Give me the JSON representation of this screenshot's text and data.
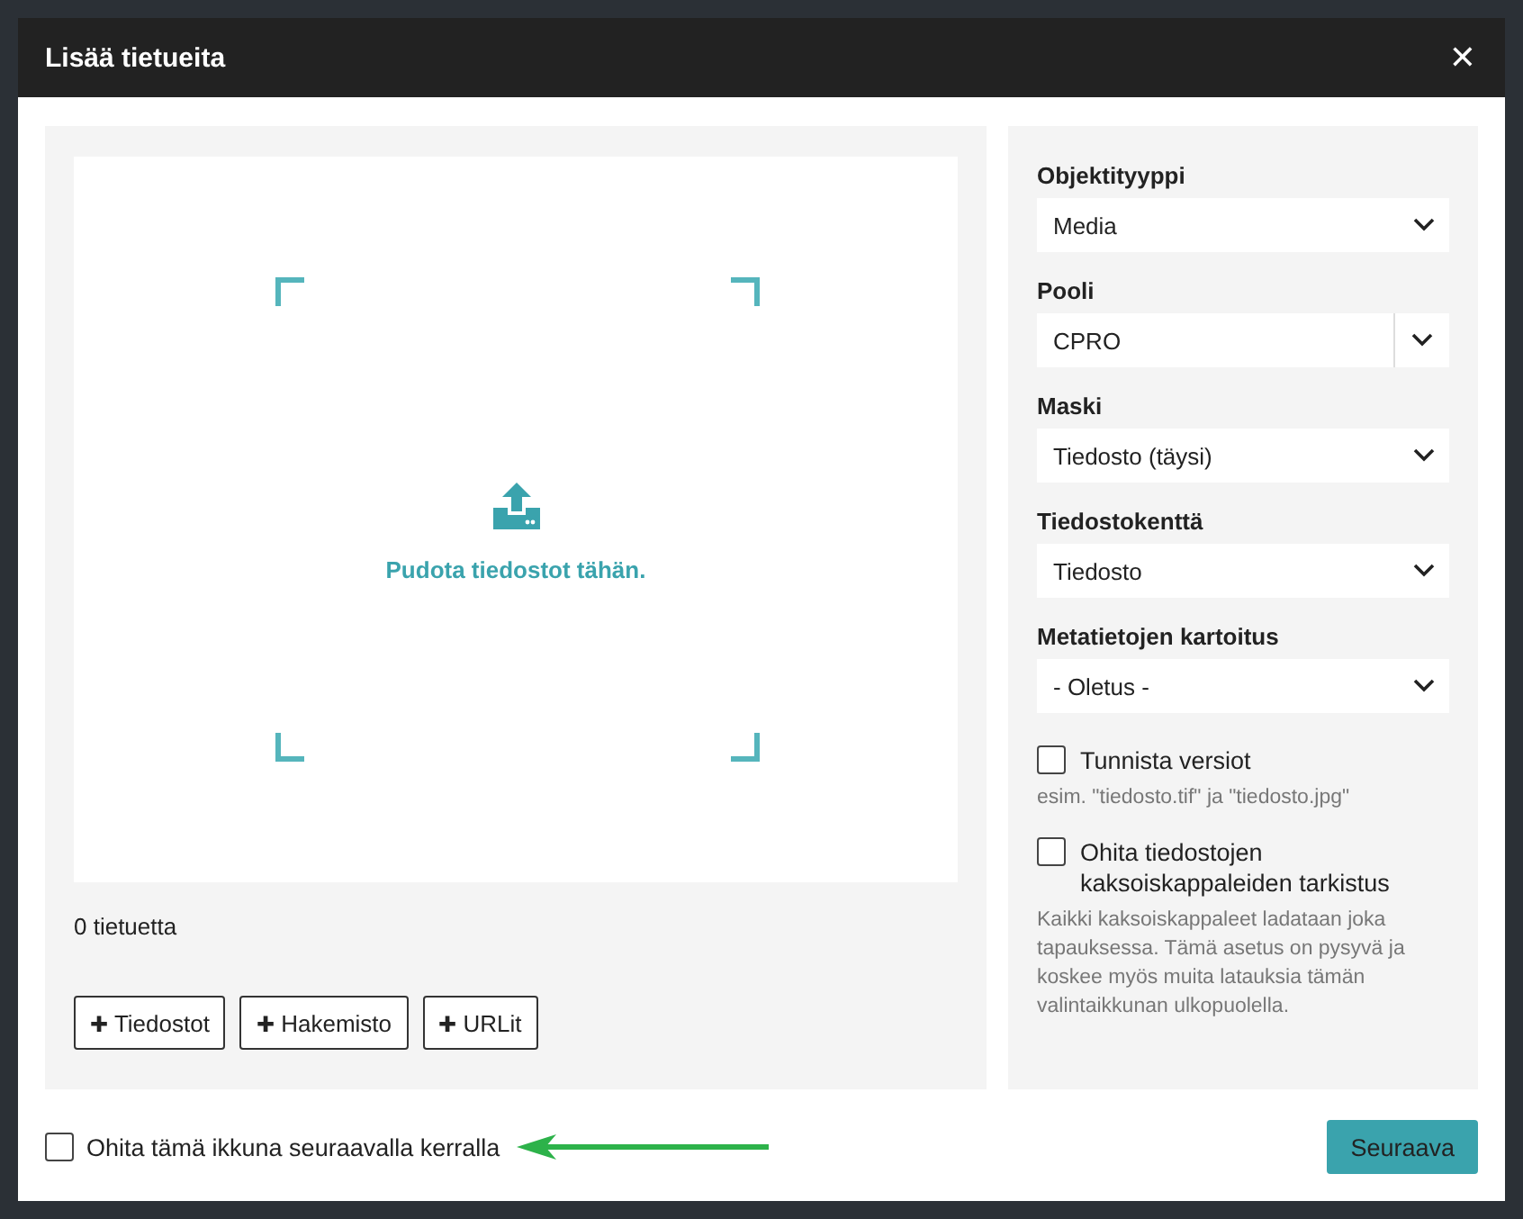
{
  "dialog": {
    "title": "Lisää tietueita",
    "close": "✕"
  },
  "drop_area": {
    "message": "Pudota tiedostot tähän."
  },
  "record_count": "0 tietuetta",
  "add_buttons": [
    {
      "symbol": "✚",
      "label": "Tiedostot"
    },
    {
      "symbol": "✚",
      "label": "Hakemisto"
    },
    {
      "symbol": "✚",
      "label": "URLit"
    }
  ],
  "settings": [
    {
      "kind": "select",
      "label": "Objektityyppi",
      "value": "Media"
    },
    {
      "kind": "split-select",
      "label": "Pooli",
      "value": "CPRO"
    },
    {
      "kind": "select",
      "label": "Maski",
      "value": "Tiedosto (täysi)"
    },
    {
      "kind": "select",
      "label": "Tiedostokenttä",
      "value": "Tiedosto"
    },
    {
      "kind": "select",
      "label": "Metatietojen kartoitus",
      "value": "- Oletus -"
    },
    {
      "kind": "checkbox",
      "label": "Tunnista versiot",
      "checked": false,
      "hint": "esim. \"tiedosto.tif\" ja \"tiedosto.jpg\""
    },
    {
      "kind": "checkbox",
      "label": "Ohita tiedostojen kaksoiskappaleiden tarkistus",
      "checked": false,
      "hint": "Kaikki kaksoiskappaleet ladataan joka tapauksessa. Tämä asetus on pysyvä ja koskee myös muita latauksia tämän valintaikkunan ulkopuolella."
    }
  ],
  "footer": {
    "skip_checkbox": {
      "label": "Ohita tämä ikkuna seuraavalla kerralla",
      "checked": false
    },
    "annotation_arrow": {
      "color": "#2db24a"
    },
    "next_button": "Seuraava"
  }
}
